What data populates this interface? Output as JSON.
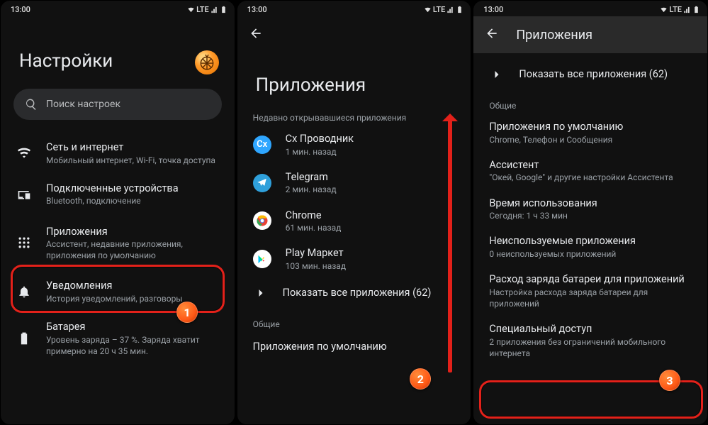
{
  "status": {
    "time": "13:00",
    "net": "LTE"
  },
  "screen1": {
    "title": "Настройки",
    "search_placeholder": "Поиск настроек",
    "items": [
      {
        "title": "Сеть и интернет",
        "sub": "Мобильный интернет, Wi-Fi, точка доступа"
      },
      {
        "title": "Подключенные устройства",
        "sub": "Bluetooth, подключение"
      },
      {
        "title": "Приложения",
        "sub": "Ассистент, недавние приложения, приложения по умолчанию"
      },
      {
        "title": "Уведомления",
        "sub": "История уведомлений, разговоры"
      },
      {
        "title": "Батарея",
        "sub": "Уровень заряда – 37 %. Заряда хватит примерно на 20 ч 35 мин."
      }
    ]
  },
  "screen2": {
    "title": "Приложения",
    "recent_label": "Недавно открывавшиеся приложения",
    "apps": [
      {
        "name": "Cx Проводник",
        "time": "1 мин. назад"
      },
      {
        "name": "Telegram",
        "time": "2 мин. назад"
      },
      {
        "name": "Chrome",
        "time": "61 мин. назад"
      },
      {
        "name": "Play Маркет",
        "time": "103 мин. назад"
      }
    ],
    "show_all": "Показать все приложения (62)",
    "general_label": "Общие",
    "default_apps": "Приложения по умолчанию"
  },
  "screen3": {
    "title": "Приложения",
    "show_all": "Показать все приложения (62)",
    "general_label": "Общие",
    "items": [
      {
        "title": "Приложения по умолчанию",
        "sub": "Chrome, Телефон и Сообщения"
      },
      {
        "title": "Ассистент",
        "sub": "\"Окей, Google\" и другие настройки Ассистента"
      },
      {
        "title": "Время использования",
        "sub": "Сегодня: 1 ч 33 мин"
      },
      {
        "title": "Неиспользуемые приложения",
        "sub": "0 неиспользуемых приложений"
      },
      {
        "title": "Расход заряда батареи для приложений",
        "sub": "Настройка расхода заряда батареи для приложений"
      },
      {
        "title": "Специальный доступ",
        "sub": "2 приложения без ограничений мобильного интернета"
      }
    ]
  },
  "steps": {
    "s1": "1",
    "s2": "2",
    "s3": "3"
  }
}
